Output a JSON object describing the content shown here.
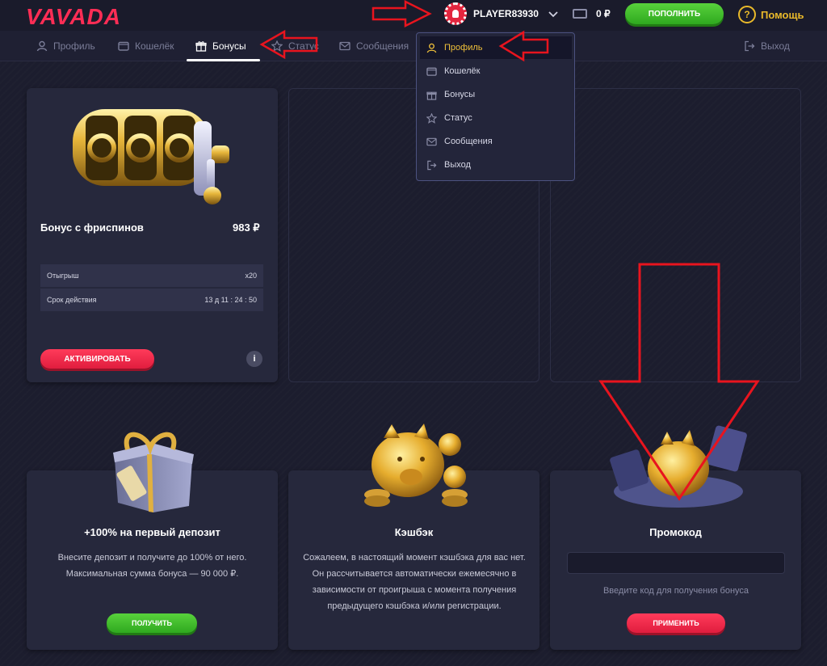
{
  "header": {
    "logo": "VAVADA",
    "username": "PLAYER83930",
    "balance": "0 ₽",
    "deposit_label": "ПОПОЛНИТЬ",
    "help_label": "Помощь",
    "help_icon_glyph": "?"
  },
  "tabs": [
    {
      "label": "Профиль",
      "icon": "user-icon"
    },
    {
      "label": "Кошелёк",
      "icon": "wallet-icon"
    },
    {
      "label": "Бонусы",
      "icon": "gift-icon",
      "active": true
    },
    {
      "label": "Статус",
      "icon": "star-icon"
    },
    {
      "label": "Сообщения",
      "icon": "mail-icon"
    },
    {
      "label": "Выход",
      "icon": "logout-icon"
    }
  ],
  "dropdown": {
    "items": [
      {
        "label": "Профиль",
        "icon": "user-icon",
        "active": true
      },
      {
        "label": "Кошелёк",
        "icon": "wallet-icon"
      },
      {
        "label": "Бонусы",
        "icon": "gift-icon"
      },
      {
        "label": "Статус",
        "icon": "star-icon"
      },
      {
        "label": "Сообщения",
        "icon": "mail-icon"
      },
      {
        "label": "Выход",
        "icon": "logout-icon"
      }
    ]
  },
  "bonus_card": {
    "title": "Бонус с фриспинов",
    "amount": "983 ₽",
    "rows": [
      {
        "label": "Отыгрыш",
        "value": "x20"
      },
      {
        "label": "Срок действия",
        "value": "13 д 11 : 24 : 50"
      }
    ],
    "activate_label": "АКТИВИРОВАТЬ",
    "info_glyph": "i"
  },
  "promos": [
    {
      "title": "+100% на первый депозит",
      "text": "Внесите депозит и получите до 100% от него. Максимальная сумма бонуса — 90 000 ₽.",
      "button": "ПОЛУЧИТЬ"
    },
    {
      "title": "Кэшбэк",
      "text": "Сожалеем, в настоящий момент кэшбэка для вас нет. Он рассчитывается автоматически ежемесячно в зависимости от проигрыша с момента получения предыдущего кэшбэка и/или регистрации."
    },
    {
      "title": "Промокод",
      "input_value": "",
      "hint": "Введите код для получения бонуса",
      "button": "ПРИМЕНИТЬ"
    }
  ],
  "colors": {
    "background": "#1c1d2e",
    "card": "#26283c",
    "accent_red": "#ff2d55",
    "accent_green": "#3cbf2a",
    "accent_gold": "#e9b92a",
    "annotation_red": "#e8141e"
  }
}
